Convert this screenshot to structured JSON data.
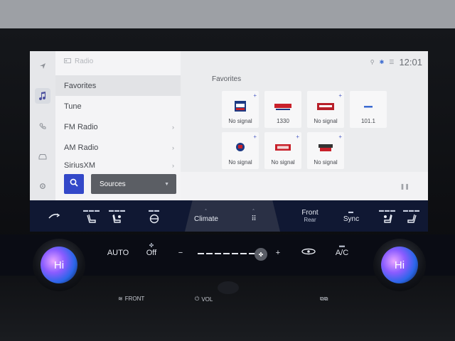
{
  "screen": {
    "app_title": "Radio",
    "status": {
      "clock": "12:01",
      "icons": [
        "location-icon",
        "bluetooth-icon",
        "signal-icon"
      ]
    },
    "nav_rail": [
      "navigation-icon",
      "music-icon",
      "phone-icon",
      "car-icon",
      "settings-icon"
    ],
    "menu": [
      {
        "label": "Favorites",
        "selected": true,
        "chevron": false
      },
      {
        "label": "Tune",
        "selected": false,
        "chevron": false
      },
      {
        "label": "FM Radio",
        "selected": false,
        "chevron": true
      },
      {
        "label": "AM Radio",
        "selected": false,
        "chevron": true
      },
      {
        "label": "SiriusXM",
        "selected": false,
        "chevron": true
      }
    ],
    "sources_label": "Sources",
    "favorites_title": "Favorites",
    "tiles": [
      {
        "label": "No signal",
        "logo": "fox-news-logo",
        "plus": true
      },
      {
        "label": "1330",
        "logo": "whbl-logo",
        "plus": false
      },
      {
        "label": "No signal",
        "logo": "news-talk-logo",
        "plus": true
      },
      {
        "label": "101.1",
        "logo": "dash-logo",
        "plus": false
      },
      {
        "label": "No signal",
        "logo": "sports-logo",
        "plus": true
      },
      {
        "label": "No signal",
        "logo": "red-logo",
        "plus": true
      },
      {
        "label": "No signal",
        "logo": "vinyl-logo",
        "plus": true
      }
    ]
  },
  "climate": {
    "tab_label": "Climate",
    "front_label": "Front",
    "rear_label": "Rear",
    "sync_label": "Sync"
  },
  "controls": {
    "auto_label": "AUTO",
    "off_label": "Off",
    "ac_label": "A/C",
    "left_temp": "Hi",
    "right_temp": "Hi",
    "front_btn": "FRONT",
    "vol_btn": "VOL"
  },
  "colors": {
    "accent": "#3348c9",
    "climate_bg": "#101833"
  }
}
